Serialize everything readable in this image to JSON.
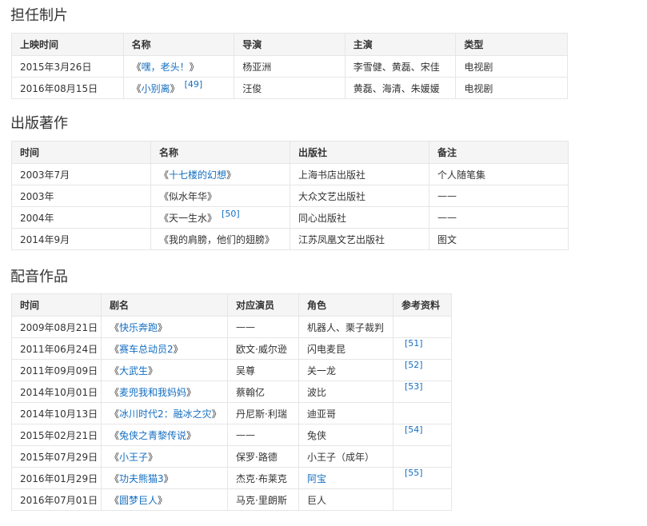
{
  "sections": [
    {
      "title": "担任制片",
      "headers": [
        "上映时间",
        "名称",
        "导演",
        "主演",
        "类型"
      ],
      "rows": [
        {
          "cells": [
            "2015年3月26日",
            "",
            "杨亚洲",
            "李雪健、黄磊、宋佳",
            "电视剧"
          ],
          "title": "嘿，老头！",
          "ref": ""
        },
        {
          "cells": [
            "2016年08月15日",
            "",
            "汪俊",
            "黄磊、海清、朱媛媛",
            "电视剧"
          ],
          "title": "小别离",
          "ref": "[49]"
        }
      ]
    },
    {
      "title": "出版著作",
      "headers": [
        "时间",
        "名称",
        "出版社",
        "备注"
      ],
      "rows": [
        {
          "cells": [
            "2003年7月",
            "",
            "上海书店出版社",
            "个人随笔集"
          ],
          "title": "十七楼的幻想",
          "title_link": true,
          "ref": ""
        },
        {
          "cells": [
            "2003年",
            "",
            "大众文艺出版社",
            "——"
          ],
          "title": "似水年华",
          "title_link": false,
          "ref": ""
        },
        {
          "cells": [
            "2004年",
            "",
            "同心出版社",
            "——"
          ],
          "title": "天一生水",
          "title_link": false,
          "ref": "[50]"
        },
        {
          "cells": [
            "2014年9月",
            "",
            "江苏凤凰文艺出版社",
            "图文"
          ],
          "title": "我的肩膀，他们的翅膀",
          "title_link": false,
          "ref": ""
        }
      ]
    },
    {
      "title": "配音作品",
      "headers": [
        "时间",
        "剧名",
        "对应演员",
        "角色",
        "参考资料"
      ],
      "rows": [
        {
          "cells": [
            "2009年08月21日",
            "",
            "——",
            "机器人、栗子裁判",
            ""
          ],
          "title": "快乐奔跑",
          "ref": ""
        },
        {
          "cells": [
            "2011年06月24日",
            "",
            "欧文·威尔逊",
            "闪电麦昆",
            "[51]"
          ],
          "title": "赛车总动员2",
          "ref": ""
        },
        {
          "cells": [
            "2011年09月09日",
            "",
            "吴尊",
            "关一龙",
            "[52]"
          ],
          "title": "大武生",
          "ref": ""
        },
        {
          "cells": [
            "2014年10月01日",
            "",
            "蔡翰亿",
            "波比",
            "[53]"
          ],
          "title": "麦兜我和我妈妈",
          "ref": ""
        },
        {
          "cells": [
            "2014年10月13日",
            "",
            "丹尼斯·利瑞",
            "迪亚哥",
            ""
          ],
          "title": "冰川时代2：融冰之灾",
          "ref": ""
        },
        {
          "cells": [
            "2015年02月21日",
            "",
            "——",
            "兔侠",
            "[54]"
          ],
          "title": "兔侠之青黎传说",
          "ref": ""
        },
        {
          "cells": [
            "2015年07月29日",
            "",
            "保罗·路德",
            "小王子（成年）",
            ""
          ],
          "title": "小王子",
          "ref": ""
        },
        {
          "cells": [
            "2016年01月29日",
            "",
            "杰克·布莱克",
            "阿宝",
            "[55]"
          ],
          "title": "功夫熊猫3",
          "ref": "",
          "role_link": true
        },
        {
          "cells": [
            "2016年07月01日",
            "",
            "马克·里朗斯",
            "巨人",
            ""
          ],
          "title": "圆梦巨人",
          "ref": ""
        }
      ]
    }
  ]
}
